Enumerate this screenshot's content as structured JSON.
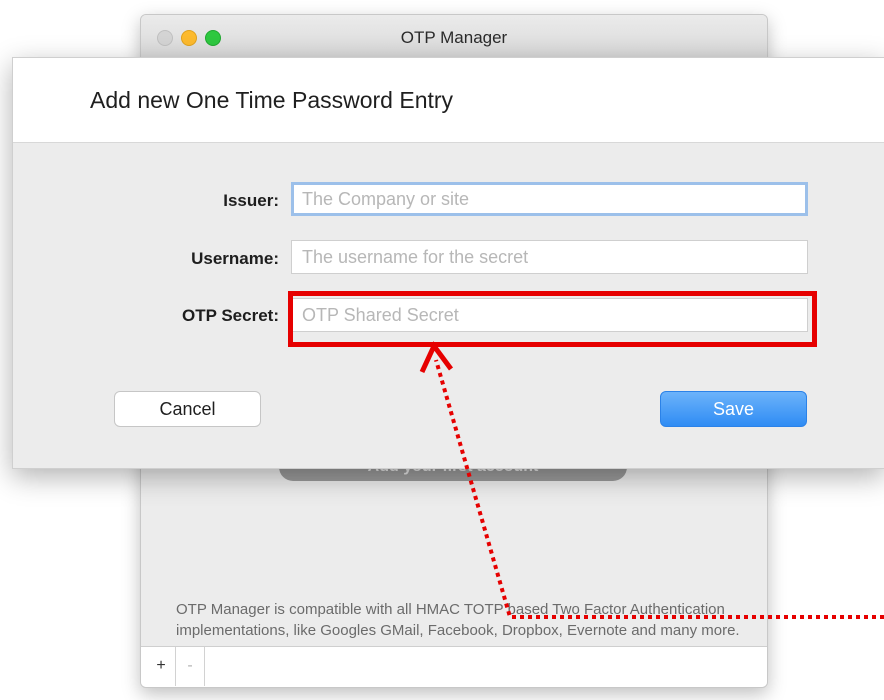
{
  "window": {
    "title": "OTP Manager",
    "add_first_account_label": "Add your first account",
    "compat_text": "OTP Manager is compatible with all HMAC TOTP based Two Factor Authentication implementations, like Googles GMail, Facebook, Dropbox, Evernote and many more.",
    "add_button_glyph": "+",
    "remove_button_glyph": "-"
  },
  "sheet": {
    "title": "Add new One Time Password Entry",
    "fields": {
      "issuer": {
        "label": "Issuer:",
        "placeholder": "The Company or site",
        "value": ""
      },
      "username": {
        "label": "Username:",
        "placeholder": "The username for the secret",
        "value": ""
      },
      "secret": {
        "label": "OTP Secret:",
        "placeholder": "OTP Shared Secret",
        "value": ""
      }
    },
    "cancel_label": "Cancel",
    "save_label": "Save"
  },
  "colors": {
    "accent": "#2f8cf4",
    "highlight": "#e60000",
    "focus_ring": "#9cc0ea"
  },
  "icons": {
    "close": "window-close-icon",
    "minimize": "window-minimize-icon",
    "maximize": "window-maximize-icon"
  }
}
